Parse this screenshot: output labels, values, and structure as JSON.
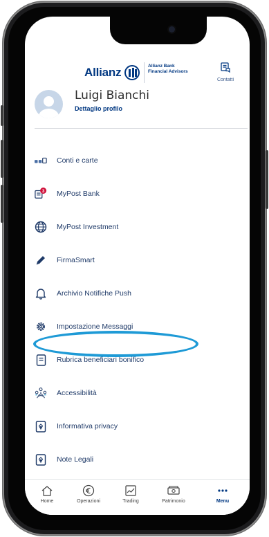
{
  "header": {
    "brand": "Allianz",
    "sub_line1": "Allianz Bank",
    "sub_line2": "Financial Advisors",
    "contacts_label": "Contatti"
  },
  "profile": {
    "name": "Luigi Bianchi",
    "detail_link": "Dettaglio profilo"
  },
  "menu": {
    "items": [
      {
        "label": "Conti e carte",
        "icon": "cards-icon"
      },
      {
        "label": "MyPost Bank",
        "icon": "mailbox-icon",
        "badge": "3"
      },
      {
        "label": "MyPost Investment",
        "icon": "globe-icon"
      },
      {
        "label": "FirmaSmart",
        "icon": "pen-icon"
      },
      {
        "label": "Archivio Notifiche Push",
        "icon": "bell-icon"
      },
      {
        "label": "Impostazione Messaggi",
        "icon": "gear-icon"
      },
      {
        "label": "Rubrica beneficiari bonifico",
        "icon": "address-book-icon"
      },
      {
        "label": "Accessibilità",
        "icon": "accessibility-icon"
      },
      {
        "label": "Informativa privacy",
        "icon": "privacy-doc-icon"
      },
      {
        "label": "Note Legali",
        "icon": "legal-doc-icon"
      }
    ],
    "highlighted": "Impostazione Messaggi",
    "highlight_color": "#1e9ad6"
  },
  "tabbar": {
    "tabs": [
      {
        "label": "Home",
        "icon": "home-icon"
      },
      {
        "label": "Operazioni",
        "icon": "euro-icon"
      },
      {
        "label": "Trading",
        "icon": "chart-icon"
      },
      {
        "label": "Patrimonio",
        "icon": "wallet-icon"
      },
      {
        "label": "Menu",
        "icon": "more-icon",
        "active": true
      }
    ]
  },
  "colors": {
    "brand_blue": "#003781",
    "text_blue": "#1f3a68",
    "badge_red": "#d0103a"
  }
}
